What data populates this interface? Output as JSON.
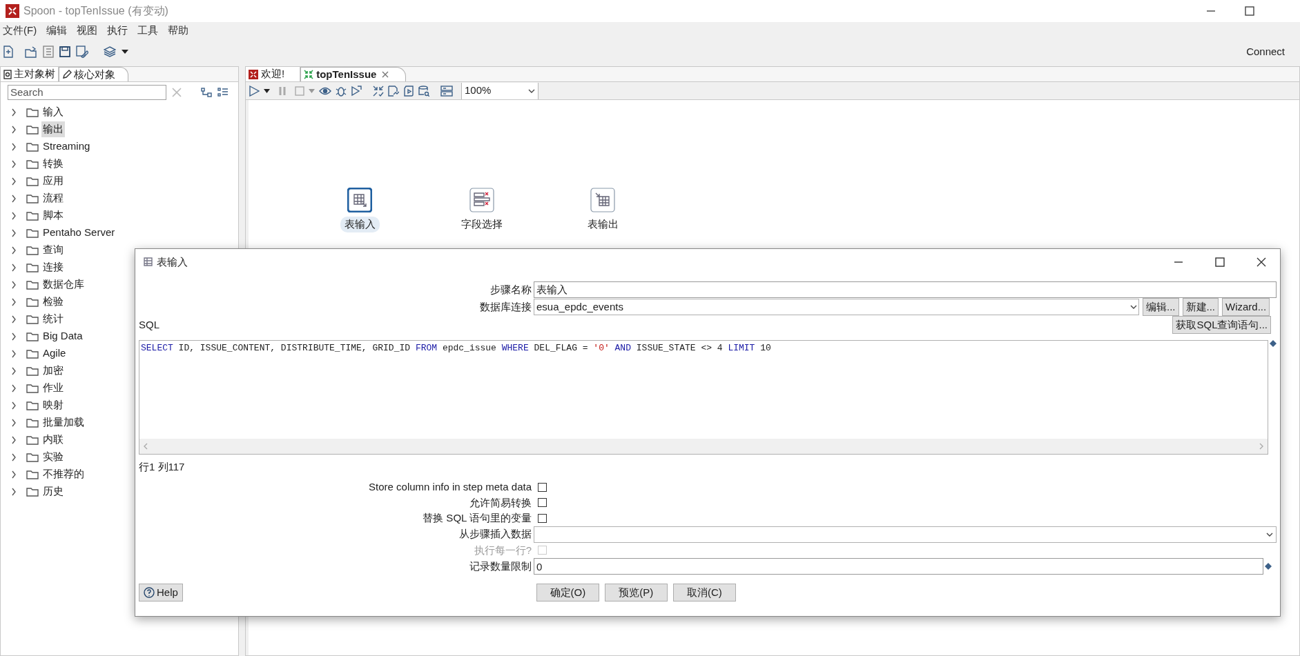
{
  "window": {
    "title": "Spoon - topTenIssue (有变动)"
  },
  "menu": [
    "文件(F)",
    "编辑",
    "视图",
    "执行",
    "工具",
    "帮助"
  ],
  "toolbar": {
    "connect": "Connect"
  },
  "left_panel": {
    "tabs": [
      {
        "label": "主对象树",
        "kind": "tree",
        "selected": false
      },
      {
        "label": "核心对象",
        "kind": "pencil",
        "selected": true
      }
    ],
    "search": {
      "placeholder": "Search"
    },
    "tree": [
      {
        "label": "输入",
        "selected": false,
        "expanded": false
      },
      {
        "label": "输出",
        "selected": true,
        "expanded": false
      },
      {
        "label": "Streaming",
        "selected": false,
        "expanded": false
      },
      {
        "label": "转换",
        "selected": false,
        "expanded": false
      },
      {
        "label": "应用",
        "selected": false,
        "expanded": false
      },
      {
        "label": "流程",
        "selected": false,
        "expanded": false
      },
      {
        "label": "脚本",
        "selected": false,
        "expanded": false
      },
      {
        "label": "Pentaho Server",
        "selected": false,
        "expanded": false
      },
      {
        "label": "查询",
        "selected": false,
        "expanded": false
      },
      {
        "label": "连接",
        "selected": false,
        "expanded": false
      },
      {
        "label": "数据仓库",
        "selected": false,
        "expanded": false
      },
      {
        "label": "检验",
        "selected": false,
        "expanded": false
      },
      {
        "label": "统计",
        "selected": false,
        "expanded": false
      },
      {
        "label": "Big Data",
        "selected": false,
        "expanded": false
      },
      {
        "label": "Agile",
        "selected": false,
        "expanded": false
      },
      {
        "label": "加密",
        "selected": false,
        "expanded": false
      },
      {
        "label": "作业",
        "selected": false,
        "expanded": false
      },
      {
        "label": "映射",
        "selected": false,
        "expanded": false
      },
      {
        "label": "批量加载",
        "selected": false,
        "expanded": false
      },
      {
        "label": "内联",
        "selected": false,
        "expanded": false
      },
      {
        "label": "实验",
        "selected": false,
        "expanded": false
      },
      {
        "label": "不推荐的",
        "selected": false,
        "expanded": false
      },
      {
        "label": "历史",
        "selected": false,
        "expanded": false
      }
    ]
  },
  "editor": {
    "tabs": [
      {
        "label": "欢迎!",
        "kind": "welcome",
        "selected": false,
        "closable": false
      },
      {
        "label": "topTenIssue",
        "kind": "transformation",
        "selected": true,
        "closable": true
      }
    ],
    "zoom": "100%",
    "steps": [
      {
        "label": "表输入",
        "kind": "table-input",
        "selected": true
      },
      {
        "label": "字段选择",
        "kind": "select-fields",
        "selected": false
      },
      {
        "label": "表输出",
        "kind": "table-output",
        "selected": false
      }
    ]
  },
  "dialog": {
    "title": "表输入",
    "step_name": {
      "label": "步骤名称",
      "value": "表输入"
    },
    "connection": {
      "label": "数据库连接",
      "value": "esua_epdc_events",
      "buttons": [
        "编辑...",
        "新建...",
        "Wizard..."
      ]
    },
    "sql_label": "SQL",
    "get_sql_button": "获取SQL查询语句...",
    "sql_tokens": [
      {
        "text": "SELECT",
        "kind": "keyword"
      },
      {
        "text": " ID, ISSUE_CONTENT, DISTRIBUTE_TIME, GRID_ID ",
        "kind": "plain"
      },
      {
        "text": "FROM",
        "kind": "keyword"
      },
      {
        "text": " epdc_issue ",
        "kind": "plain"
      },
      {
        "text": "WHERE",
        "kind": "keyword"
      },
      {
        "text": " DEL_FLAG = ",
        "kind": "plain"
      },
      {
        "text": "'0'",
        "kind": "string"
      },
      {
        "text": " AND ",
        "kind": "keyword"
      },
      {
        "text": "ISSUE_STATE <> 4 ",
        "kind": "plain"
      },
      {
        "text": "LIMIT",
        "kind": "keyword"
      },
      {
        "text": " 10",
        "kind": "plain"
      }
    ],
    "cursor_position": "行1 列117",
    "options": [
      {
        "label": "Store column info in step meta data",
        "kind": "checkbox",
        "checked": false,
        "disabled": false
      },
      {
        "label": "允许简易转换",
        "kind": "checkbox",
        "checked": false,
        "disabled": false
      },
      {
        "label": "替换 SQL 语句里的变量",
        "kind": "checkbox",
        "checked": false,
        "disabled": false
      },
      {
        "label": "从步骤插入数据",
        "kind": "dropdown",
        "disabled": false
      },
      {
        "label": "执行每一行?",
        "kind": "checkbox",
        "checked": false,
        "disabled": true
      },
      {
        "label": "记录数量限制",
        "kind": "text",
        "value": "0",
        "disabled": false
      }
    ],
    "help_button": "Help",
    "buttons": [
      "确定(O)",
      "预览(P)",
      "取消(C)"
    ]
  }
}
